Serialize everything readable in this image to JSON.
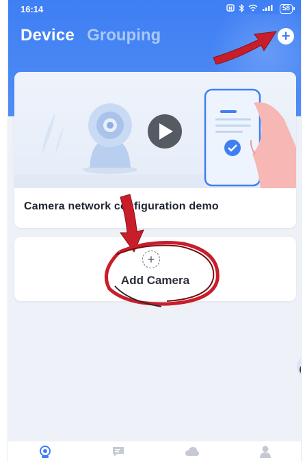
{
  "status_bar": {
    "time": "16:14",
    "icons": [
      "nfc-icon",
      "bluetooth-icon",
      "wifi-icon",
      "signal-icon"
    ],
    "battery": "58"
  },
  "header": {
    "tabs": [
      {
        "label": "Device",
        "active": true
      },
      {
        "label": "Grouping",
        "active": false
      }
    ],
    "add_icon": "plus-circle-icon",
    "accent_color": "#3f7ff4"
  },
  "demo_card": {
    "title": "Camera network configuration demo",
    "banner_icons": [
      "camera-illustration-icon",
      "play-icon",
      "phone-illustration-icon",
      "checkmark-icon"
    ]
  },
  "add_camera": {
    "label": "Add Camera",
    "icon": "dashed-plus-icon"
  },
  "bottom_nav": [
    {
      "icon": "camera-nav-icon",
      "active": true
    },
    {
      "icon": "message-nav-icon",
      "active": false
    },
    {
      "icon": "cloud-nav-icon",
      "active": false
    },
    {
      "icon": "profile-nav-icon",
      "active": false
    }
  ],
  "annotation_color": "#c81e2a"
}
